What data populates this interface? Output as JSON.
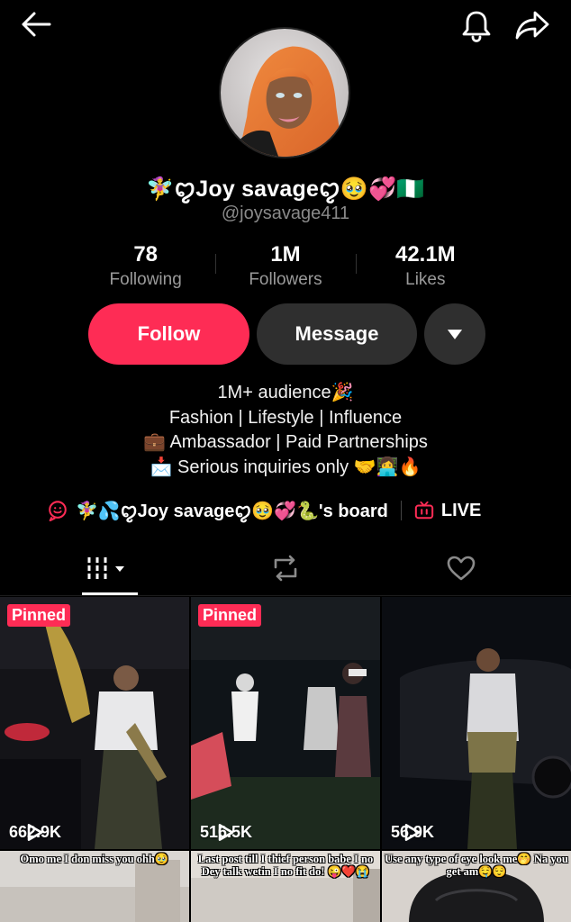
{
  "header": {
    "back_icon": "arrow-left-icon",
    "notification_icon": "bell-icon",
    "share_icon": "share-arrow-icon"
  },
  "profile": {
    "display_name": "🧚‍♀️ꨄ︎Joy savageꨄ︎🥹💞🇳🇬",
    "username": "@joysavage411",
    "avatar": "profile-photo"
  },
  "stats": [
    {
      "value": "78",
      "label": "Following"
    },
    {
      "value": "1M",
      "label": "Followers"
    },
    {
      "value": "42.1M",
      "label": "Likes"
    }
  ],
  "actions": {
    "follow_label": "Follow",
    "message_label": "Message",
    "more_icon": "caret-down-icon"
  },
  "bio": [
    "1M+ audience🎉",
    "Fashion | Lifestyle | Influence",
    "💼 Ambassador | Paid Partnerships",
    "📩 Serious inquiries only 🤝👩‍💻🔥"
  ],
  "links": {
    "board_label": "🧚‍♀️💦ꨄ︎Joy savageꨄ︎🥹💞🐍's board",
    "live_label": "LIVE"
  },
  "tabs": [
    {
      "name": "videos",
      "icon": "grid-bars-icon",
      "active": true
    },
    {
      "name": "reposts",
      "icon": "repost-icon",
      "active": false
    },
    {
      "name": "liked",
      "icon": "heart-icon",
      "active": false
    }
  ],
  "videos": [
    {
      "badge": "Pinned",
      "views": "662.9K"
    },
    {
      "badge": "Pinned",
      "views": "516.5K"
    },
    {
      "badge": "",
      "views": "56.9K"
    },
    {
      "caption": "Omo me I don miss you ohh🥹"
    },
    {
      "caption": "Last post till I thief person babe I no Dey talk wetin I no fit do! 😜❤️😭"
    },
    {
      "caption": "Use any type of eye look me🤭 Na you get am🤤😌"
    }
  ],
  "colors": {
    "background": "#000000",
    "accent": "#fe2c55",
    "button_dark": "#2f2f2f",
    "muted_text": "#8a8a8a"
  }
}
